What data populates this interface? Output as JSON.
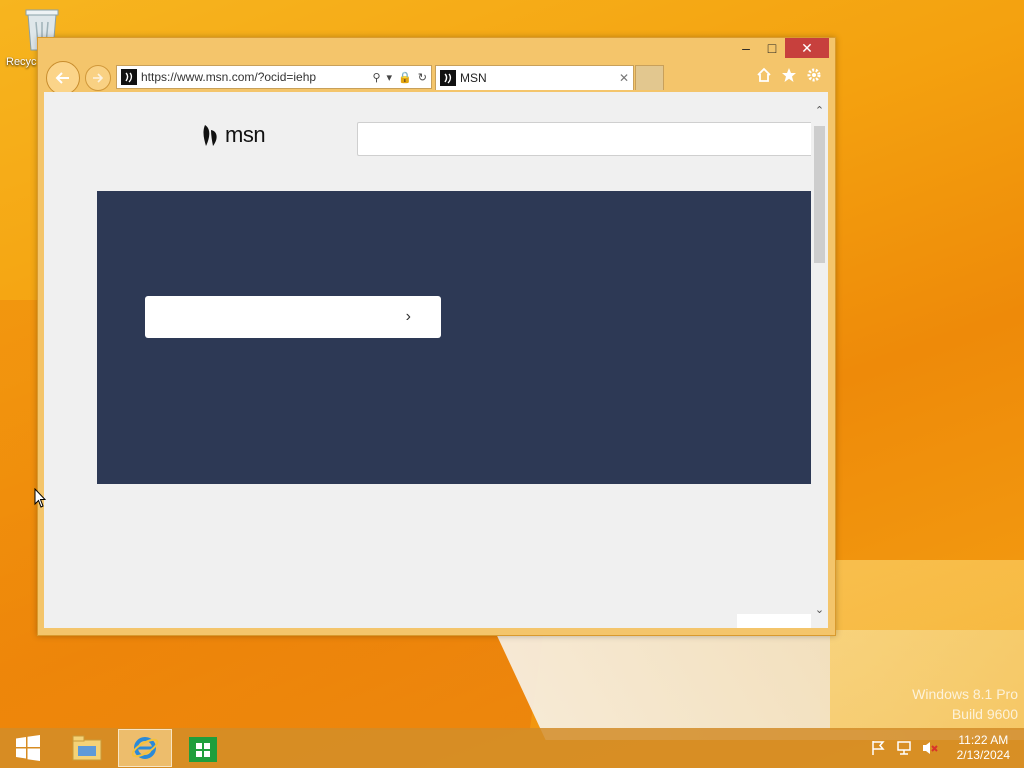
{
  "desktop": {
    "recycle_bin_label": "Recyc",
    "watermark_line1": "Windows 8.1 Pro",
    "watermark_line2": "Build 9600"
  },
  "window": {
    "controls": {
      "minimize_icon": "minimize-icon",
      "maximize_icon": "maximize-icon",
      "close_icon": "close-icon"
    },
    "address_url": "https://www.msn.com/?ocid=iehp",
    "tab_title": "MSN",
    "toolbar_icons": [
      "home-icon",
      "favorites-star-icon",
      "settings-gear-icon"
    ]
  },
  "page": {
    "logo_text": "msn",
    "search_placeholder": "",
    "hero_button_label": "",
    "hero_color": "#2d3955"
  },
  "taskbar": {
    "items": [
      "start-icon",
      "file-explorer-icon",
      "internet-explorer-icon",
      "store-icon"
    ],
    "time": "11:22 AM",
    "date": "2/13/2024",
    "tray_icons": [
      "action-center-flag-icon",
      "network-icon",
      "volume-muted-icon"
    ]
  }
}
